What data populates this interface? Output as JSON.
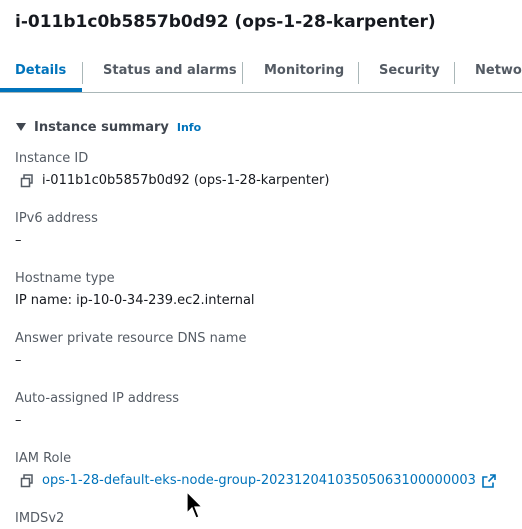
{
  "page_title": "i-011b1c0b5857b0d92 (ops-1-28-karpenter)",
  "tabs": [
    {
      "label": "Details",
      "active": true
    },
    {
      "label": "Status and alarms",
      "active": false
    },
    {
      "label": "Monitoring",
      "active": false
    },
    {
      "label": "Security",
      "active": false
    },
    {
      "label": "Networ",
      "active": false
    }
  ],
  "section": {
    "title": "Instance summary",
    "info_label": "Info",
    "caret_icon": "caret-down-icon"
  },
  "fields": {
    "instance_id": {
      "label": "Instance ID",
      "value": "i-011b1c0b5857b0d92 (ops-1-28-karpenter)"
    },
    "ipv6_address": {
      "label": "IPv6 address",
      "value": "–"
    },
    "hostname_type": {
      "label": "Hostname type",
      "value": "IP name: ip-10-0-34-239.ec2.internal"
    },
    "answer_private_dns": {
      "label": "Answer private resource DNS name",
      "value": "–"
    },
    "auto_assigned_ip": {
      "label": "Auto-assigned IP address",
      "value": "–"
    },
    "iam_role": {
      "label": "IAM Role",
      "value": "ops-1-28-default-eks-node-group-20231204103505063100000003"
    },
    "imdsv2": {
      "label": "IMDSv2"
    }
  },
  "colors": {
    "accent": "#0073bb",
    "text": "#16191f",
    "label": "#545b64",
    "border": "#aab7b8"
  },
  "icons": [
    "copy-icon",
    "external-link-icon",
    "caret-down-icon",
    "mouse-pointer-icon"
  ]
}
